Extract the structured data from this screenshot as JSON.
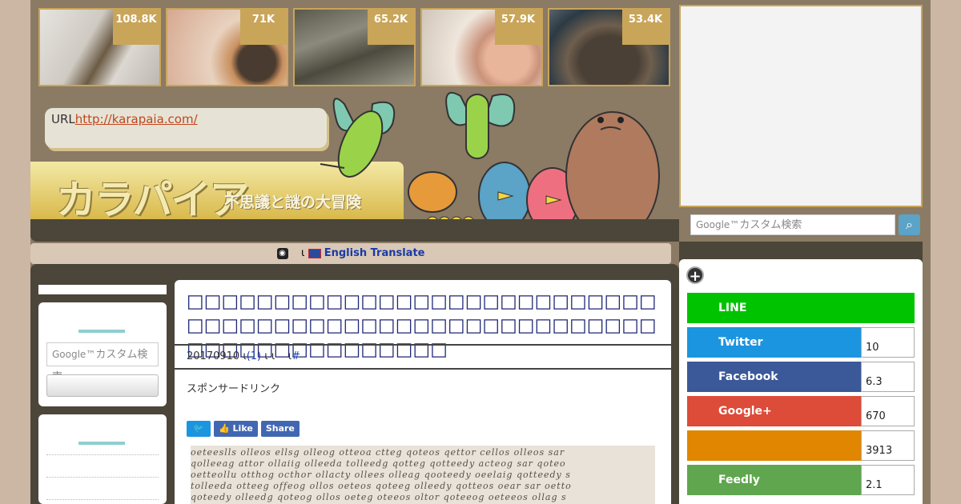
{
  "thumbnails": [
    {
      "count": "108.8K",
      "icon": "figure-photo"
    },
    {
      "count": "71K",
      "icon": "kitten-photo"
    },
    {
      "count": "65.2K",
      "icon": "cats-photo"
    },
    {
      "count": "57.9K",
      "icon": "face-photo"
    },
    {
      "count": "53.4K",
      "icon": "object-photo"
    }
  ],
  "header": {
    "url_label": "URL",
    "url_link": "http://karapaia.com/",
    "logo_text": "カラパイア",
    "logo_subtitle": "不思議と謎の大冒険"
  },
  "translate_bar": {
    "separator": "ι",
    "label": "English Translate"
  },
  "left_sidebar": {
    "search_placeholder_brand": "Google™",
    "search_placeholder_text": "カスタム検索"
  },
  "article": {
    "title": "□□□□□□□□□□□□□□□□□□□□□□□□□□□□□□□□□□□□□□□□□□□□□□□□□□□□□□□□□□□□□□□□□□□□□",
    "date": "20170910",
    "sep1": "ι",
    "comments": "(1)",
    "sep2": "ι ι",
    "sep3": "ι",
    "hash": "#",
    "sponsored": "スポンサードリンク",
    "share_like": "Like",
    "share_share": "Share"
  },
  "right_sidebar": {
    "search_placeholder_brand": "Google™",
    "search_placeholder_text": "カスタム検索",
    "social": [
      {
        "name": "LINE",
        "count": "",
        "color": "#00c300"
      },
      {
        "name": "Twitter",
        "count": "10",
        "color": "#1b95e0"
      },
      {
        "name": "Facebook",
        "count": "6.3",
        "color": "#3b5998"
      },
      {
        "name": "Google+",
        "count": "670",
        "color": "#dd4b39"
      },
      {
        "name": "",
        "count": "3913",
        "color": "#e08600"
      },
      {
        "name": "Feedly",
        "count": "2.1",
        "color": "#5fa64e"
      }
    ]
  },
  "colors": {
    "accent_gold": "#c9a55a",
    "title_blue": "#1c2574",
    "teal": "#8fcfd1"
  }
}
